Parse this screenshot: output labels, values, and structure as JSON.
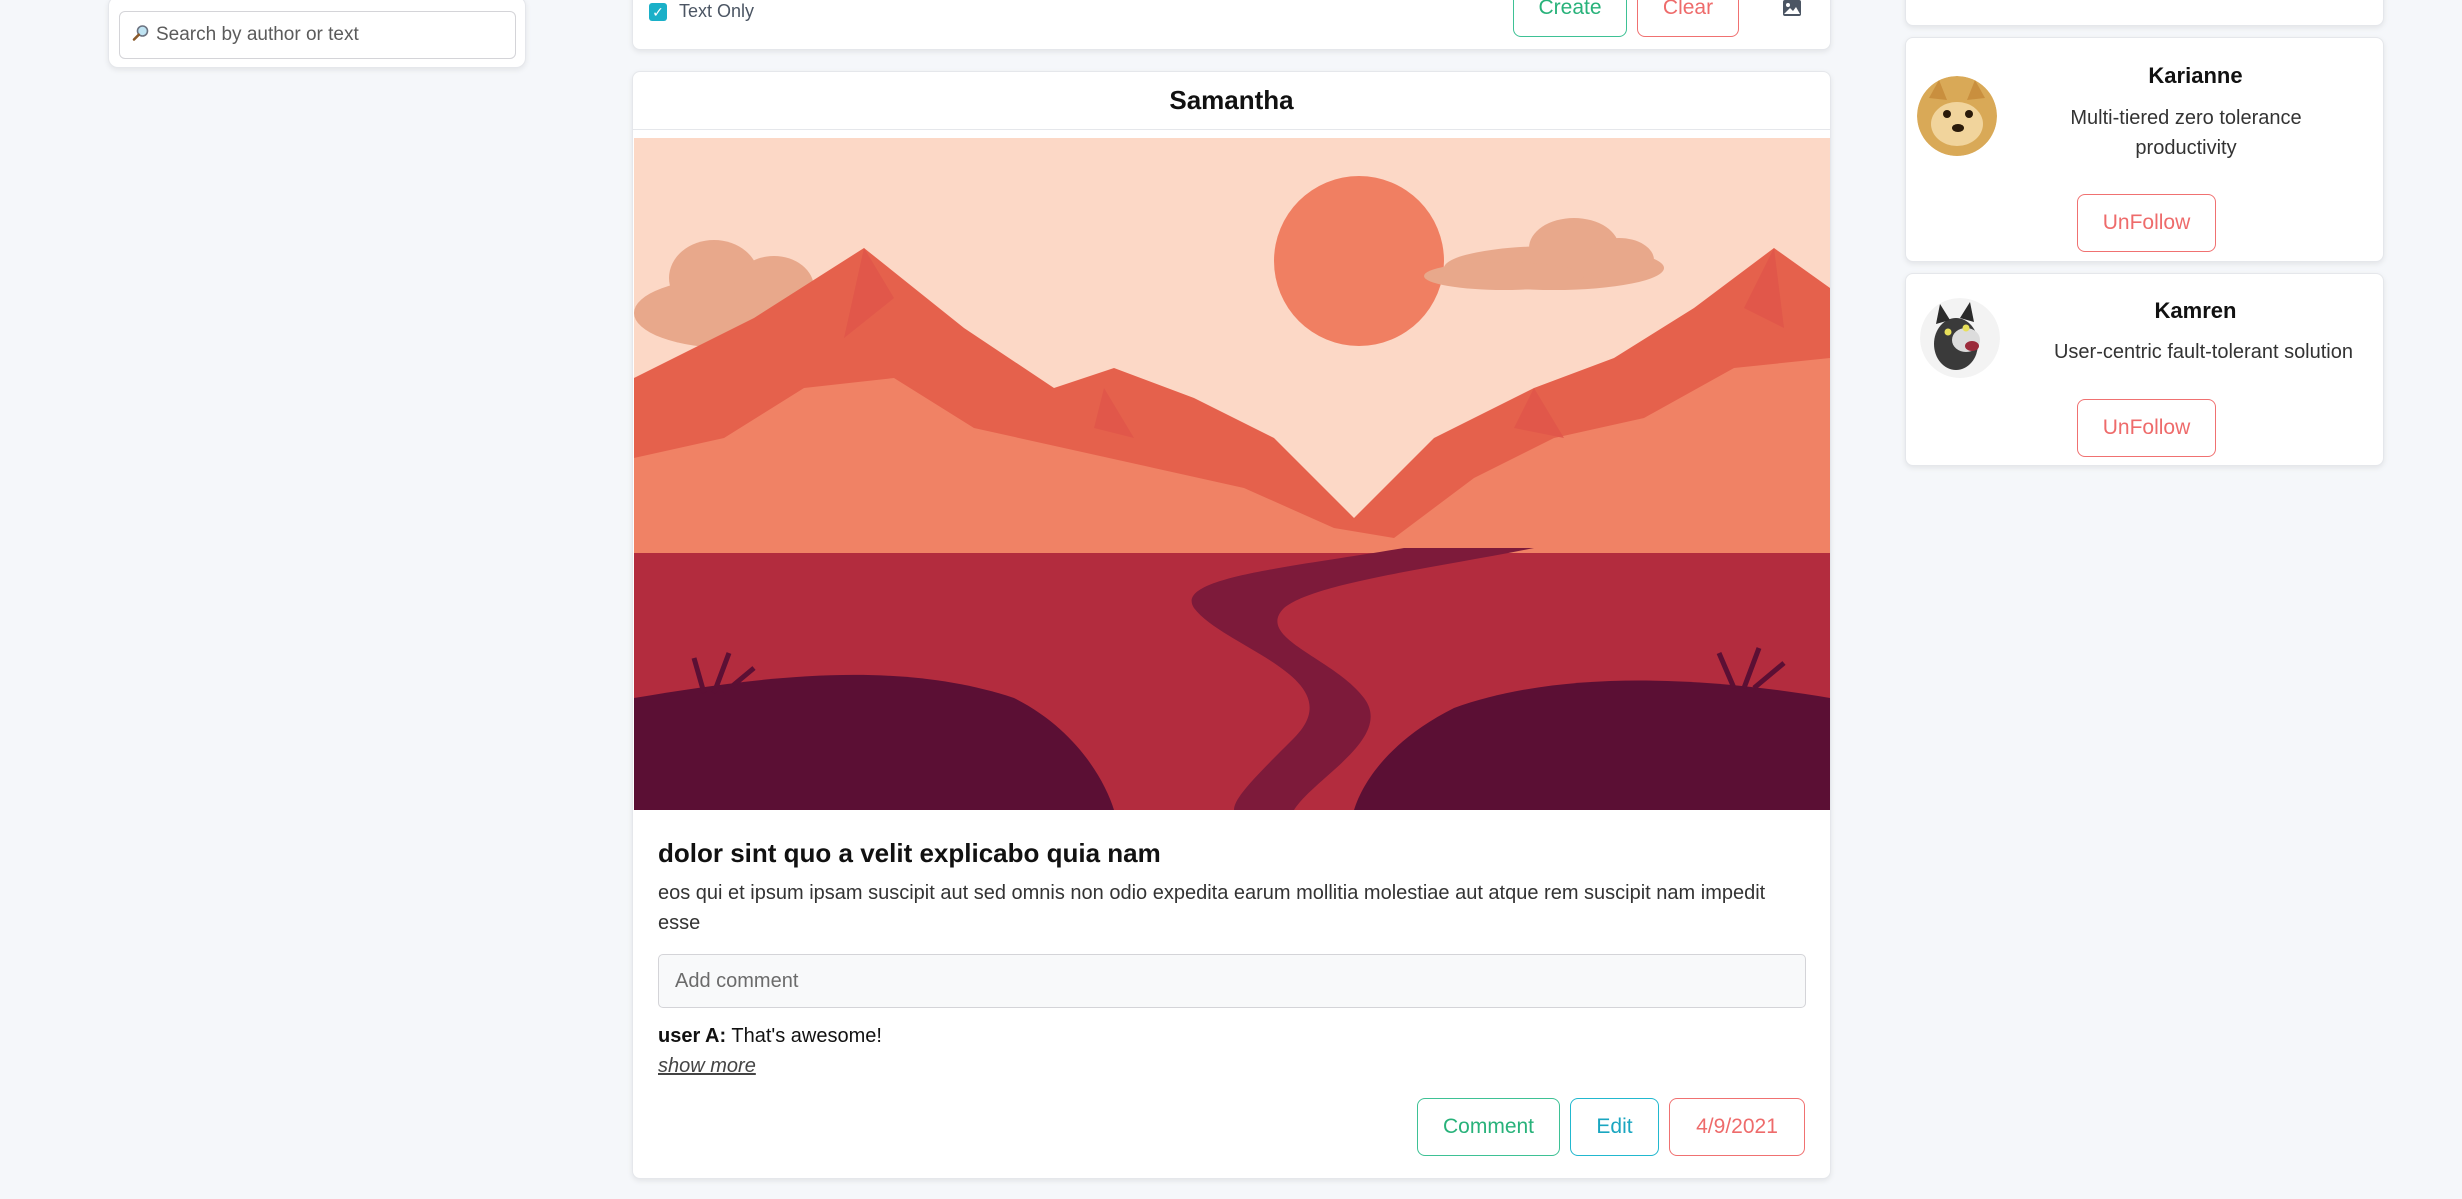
{
  "search": {
    "placeholder": "Search by author or text"
  },
  "composer": {
    "text_only_label": "Text Only",
    "text_only_checked": true,
    "create_label": "Create",
    "clear_label": "Clear",
    "image_icon": "image-icon"
  },
  "post": {
    "author": "Samantha",
    "image_description": "mountain-landscape-illustration",
    "title": "dolor sint quo a velit explicabo quia nam",
    "body": "eos qui et ipsum ipsam suscipit aut sed omnis non odio expedita earum mollitia molestiae aut atque rem suscipit nam impedit esse",
    "comment_placeholder": "Add comment",
    "comments": [
      {
        "user": "user A:",
        "text": "That's awesome!"
      }
    ],
    "show_more_label": "show more",
    "comment_button": "Comment",
    "edit_button": "Edit",
    "date": "4/9/2021"
  },
  "following": [
    {
      "name": "Karianne",
      "bio": "Multi-tiered zero tolerance productivity",
      "button": "UnFollow",
      "avatar": "doge-avatar"
    },
    {
      "name": "Kamren",
      "bio": "User-centric fault-tolerant solution",
      "button": "UnFollow",
      "avatar": "cat-avatar"
    }
  ],
  "colors": {
    "green": "#28b27a",
    "red": "#ee6b6b",
    "cyan": "#1aa6c0",
    "checkbox": "#1ab0c8"
  }
}
